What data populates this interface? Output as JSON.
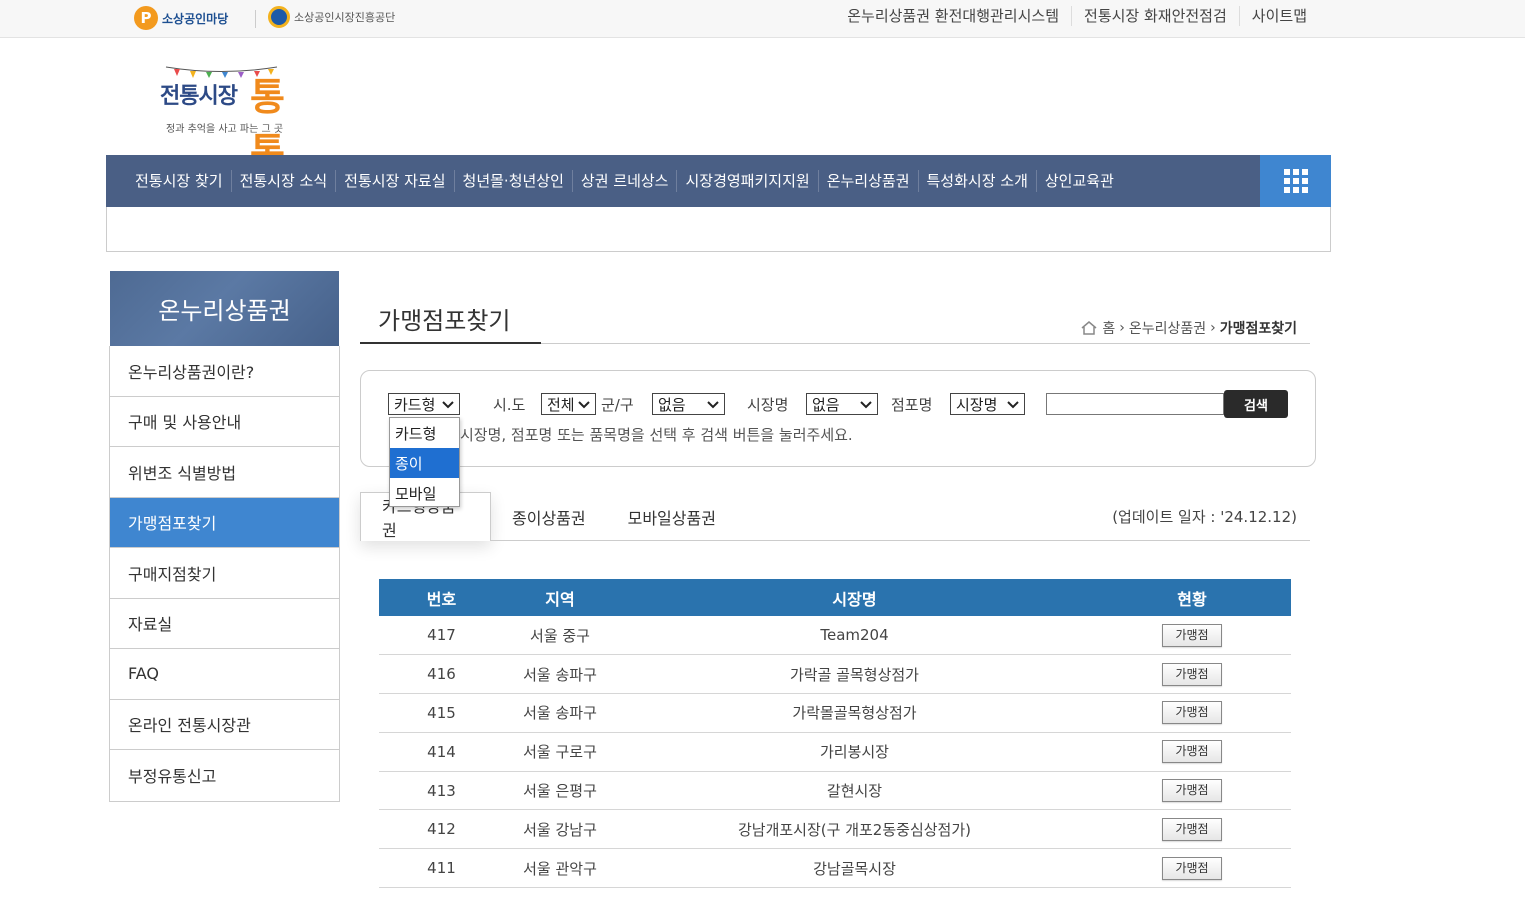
{
  "topbar": {
    "logo_a": "소상공인마당",
    "logo_b": "소상공인시장진흥공단",
    "links": [
      "온누리상품권 환전대행관리시스템",
      "전통시장 화재안전점검",
      "사이트맵"
    ]
  },
  "brand": {
    "name_main": "전통시장",
    "name_accent": "통통",
    "tagline": "정과 추억을 사고 파는 그 곳"
  },
  "gnb": {
    "items": [
      "전통시장 찾기",
      "전통시장 소식",
      "전통시장 자료실",
      "청년몰·청년상인",
      "상권 르네상스",
      "시장경영패키지지원",
      "온누리상품권",
      "특성화시장 소개",
      "상인교육관"
    ],
    "all_menu_icon": "grid-menu-icon"
  },
  "lnb": {
    "title": "온누리상품권",
    "items": [
      "온누리상품권이란?",
      "구매 및 사용안내",
      "위변조 식별방법",
      "가맹점포찾기",
      "구매지점찾기",
      "자료실",
      "FAQ",
      "온라인 전통시장관",
      "부정유통신고"
    ],
    "active_index": 3
  },
  "page": {
    "title": "가맹점포찾기",
    "breadcrumb": [
      "홈",
      "온누리상품권",
      "가맹점포찾기"
    ]
  },
  "search": {
    "type_value": "카드형",
    "sido_label": "시.도",
    "sido_value": "전체",
    "gugun_label": "군/구",
    "gugun_value": "없음",
    "market_label": "시장명",
    "market_value": "없음",
    "store_label": "점포명",
    "store_value": "시장명",
    "keyword_value": "",
    "button": "검색",
    "hint": "시장명, 점포명 또는 품목명을 선택 후 검색 버튼을 눌러주세요.",
    "dropdown_options": [
      "카드형",
      "종이",
      "모바일"
    ],
    "dropdown_highlighted": 1
  },
  "tabs": [
    "카드형상품권",
    "종이상품권",
    "모바일상품권"
  ],
  "update_text": "(업데이트 일자 : '24.12.12)",
  "table": {
    "headers": [
      "번호",
      "지역",
      "시장명",
      "현황"
    ],
    "button_label": "가맹점",
    "rows": [
      [
        "417",
        "서울 중구",
        "Team204"
      ],
      [
        "416",
        "서울 송파구",
        "가락골 골목형상점가"
      ],
      [
        "415",
        "서울 송파구",
        "가락몰골목형상점가"
      ],
      [
        "414",
        "서울 구로구",
        "가리봉시장"
      ],
      [
        "413",
        "서울 은평구",
        "갈현시장"
      ],
      [
        "412",
        "서울 강남구",
        "강남개포시장(구 개포2동중심상점가)"
      ],
      [
        "411",
        "서울 관악구",
        "강남골목시장"
      ]
    ]
  },
  "colors": {
    "nav_bg": "#4a5f85",
    "accent_blue": "#3f86d0",
    "table_header": "#2a73ae",
    "brand_orange": "#f08a1c"
  }
}
